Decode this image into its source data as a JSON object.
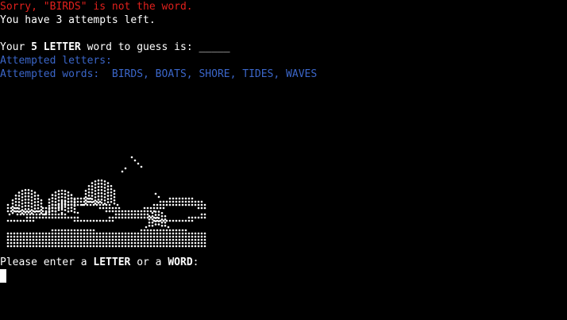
{
  "terminal": {
    "error_message": "Sorry, \"BIRDS\" is not the word.",
    "attempts_message": "You have 3 attempts left.",
    "word_prompt": {
      "prefix": "Your ",
      "letter_count": "5 LETTER",
      "suffix": " word to guess is: ",
      "blank": "_____"
    },
    "attempted_letters_label": "Attempted letters:",
    "attempted_letters_value": "",
    "attempted_words_label": "Attempted words:",
    "attempted_words_value": "BIRDS, BOATS, SHORE, TIDES, WAVES",
    "input_prompt": {
      "prefix": "Please enter a ",
      "letter": "LETTER",
      "middle": " or a ",
      "word": "WORD",
      "suffix": ":"
    },
    "art_name": "waves-ascii-art",
    "colors": {
      "background": "#000000",
      "text": "#ffffff",
      "error": "#e0201c",
      "info": "#3b66c9"
    }
  }
}
